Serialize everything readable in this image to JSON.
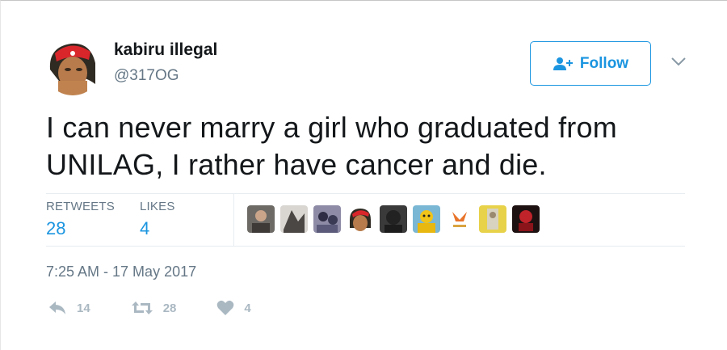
{
  "user": {
    "name": "kabiru illegal",
    "handle": "@317OG"
  },
  "follow_button": {
    "label": "Follow"
  },
  "tweet": {
    "line1": "I can never marry a girl who graduated from",
    "line2": "UNILAG, I rather have cancer and die."
  },
  "stats": {
    "retweets_label": "RETWEETS",
    "retweets_value": "28",
    "likes_label": "LIKES",
    "likes_value": "4"
  },
  "timestamp": "7:25 AM - 17 May 2017",
  "actions": {
    "reply_count": "14",
    "retweet_count": "28",
    "like_count": "4"
  },
  "colors": {
    "accent": "#1b95e0",
    "text": "#14171a",
    "muted": "#657786",
    "action_gray": "#aab8c2"
  }
}
